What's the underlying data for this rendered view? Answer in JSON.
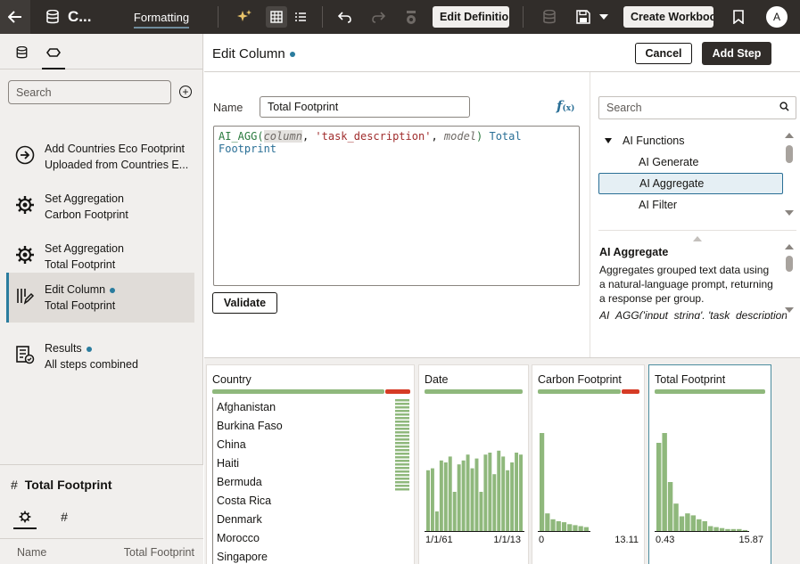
{
  "topbar": {
    "title": "C...",
    "formatting_tab": "Formatting",
    "edit_definition_button": "Edit Definition",
    "create_workbook_button": "Create Workbook",
    "avatar_initial": "A"
  },
  "left_panel": {
    "search_placeholder": "Search",
    "steps": [
      {
        "line1": "Add Countries Eco Footprint",
        "line2": "Uploaded from Countries E...",
        "icon": "arrow-circle-icon",
        "active": false,
        "dot": false
      },
      {
        "line1": "Set Aggregation",
        "line2": "Carbon Footprint",
        "icon": "gear-icon",
        "active": false,
        "dot": false
      },
      {
        "line1": "Set Aggregation",
        "line2": "Total Footprint",
        "icon": "gear-icon",
        "active": false,
        "dot": false
      },
      {
        "line1": "Edit Column",
        "line2": "Total Footprint",
        "icon": "edit-column-icon",
        "active": true,
        "dot": true
      },
      {
        "line1": "Results",
        "line2": "All steps combined",
        "icon": "results-icon",
        "active": false,
        "dot": true
      }
    ],
    "column_props": {
      "title": "Total Footprint",
      "name_label": "Name",
      "name_value": "Total Footprint"
    }
  },
  "main": {
    "title": "Edit Column",
    "cancel_button": "Cancel",
    "add_step_button": "Add Step",
    "name_label": "Name",
    "name_value": "Total Footprint",
    "fx_label": "f",
    "fx_sub": "(x)",
    "expression": {
      "fn": "AI_AGG(",
      "param1": "column",
      "sep1": ", ",
      "str": "'task_description'",
      "sep2": ", ",
      "param2": "model",
      "close": ")",
      "col": " Total Footprint"
    },
    "validate_button": "Validate"
  },
  "functions": {
    "search_placeholder": "Search",
    "group": "AI Functions",
    "items": [
      "AI Generate",
      "AI Aggregate",
      "AI Filter"
    ],
    "selected": "AI Aggregate",
    "help_title": "AI Aggregate",
    "help_description": "Aggregates grouped text data using a natural-language prompt, returning a response per group.",
    "help_signature": "AI_AGG('input_string', 'task_description'"
  },
  "profile": {
    "country": {
      "header": "Country",
      "values": [
        "Afghanistan",
        "Burkina Faso",
        "China",
        "Haiti",
        "Bermuda",
        "Costa Rica",
        "Denmark",
        "Morocco",
        "Singapore"
      ],
      "quality_valid_fraction": 0.87
    },
    "date": {
      "header": "Date",
      "axis_min": "1/1/61",
      "axis_max": "1/1/13",
      "bins": [
        0.62,
        0.64,
        0.2,
        0.72,
        0.7,
        0.76,
        0.4,
        0.68,
        0.72,
        0.78,
        0.64,
        0.74,
        0.4,
        0.78,
        0.8,
        0.58,
        0.82,
        0.76,
        0.62,
        0.7,
        0.8,
        0.78
      ],
      "quality_valid_fraction": 1.0
    },
    "carbon": {
      "header": "Carbon Footprint",
      "axis_min": "0",
      "axis_max": "13.11",
      "bins": [
        1.0,
        0.18,
        0.12,
        0.1,
        0.09,
        0.07,
        0.06,
        0.05,
        0.04
      ],
      "quality_valid_fraction": 0.82
    },
    "total": {
      "header": "Total Footprint",
      "axis_min": "0.43",
      "axis_max": "15.87",
      "bins": [
        0.9,
        1.0,
        0.5,
        0.28,
        0.15,
        0.18,
        0.16,
        0.12,
        0.1,
        0.05,
        0.04,
        0.03,
        0.02,
        0.02,
        0.02,
        0.01
      ],
      "quality_valid_fraction": 1.0
    }
  },
  "colors": {
    "accent": "#2a7c9e",
    "bar_green": "#8fb87c",
    "bar_red": "#d63b25",
    "topbar": "#312d2a"
  }
}
